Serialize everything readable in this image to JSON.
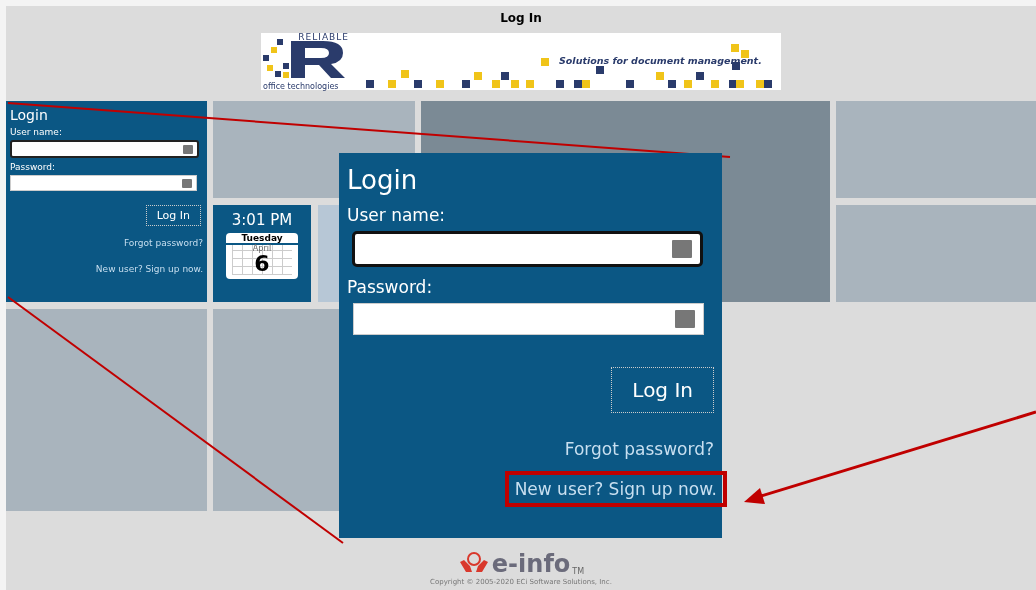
{
  "title": "Log In",
  "banner": {
    "brand": "RELIABLE",
    "subtitle": "office technologies",
    "tagline": "Solutions for document management."
  },
  "login": {
    "heading": "Login",
    "username_label": "User name:",
    "password_label": "Password:",
    "button": "Log In",
    "forgot": "Forgot password?",
    "signup": "New user? Sign up now."
  },
  "clock": {
    "time": "3:01 PM",
    "day": "Tuesday",
    "month": "April",
    "date": "6"
  },
  "callout": {
    "heading": "Login",
    "username_label": "User name:",
    "password_label": "Password:",
    "button": "Log In",
    "forgot": "Forgot password?",
    "signup": "New user? Sign up now."
  },
  "footer": {
    "logo": "e-info",
    "trademark": "TM",
    "copyright": "Copyright © 2005-2020 ECi Software Solutions, Inc."
  }
}
